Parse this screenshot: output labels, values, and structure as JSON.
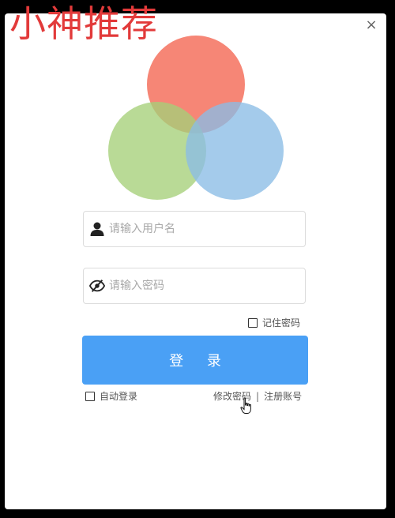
{
  "watermark": {
    "text": "小神推荐"
  },
  "dialog": {
    "close_symbol": "×",
    "logo": {
      "icon": "three-overlapping-circles-logo",
      "colors": {
        "top": "#f4644f",
        "left": "#a5d079",
        "right": "#8bbce6"
      }
    }
  },
  "form": {
    "username": {
      "placeholder": "请输入用户名",
      "value": "",
      "icon": "user-icon"
    },
    "password": {
      "placeholder": "请输入密码",
      "value": "",
      "icon": "eye-slash-icon"
    },
    "remember_label": "记住密码",
    "login_label": "登 录",
    "auto_login_label": "自动登录",
    "change_password_label": "修改密码",
    "separator": "|",
    "register_label": "注册账号"
  },
  "colors": {
    "accent": "#4aa0f5",
    "watermark": "#e23a3a"
  }
}
